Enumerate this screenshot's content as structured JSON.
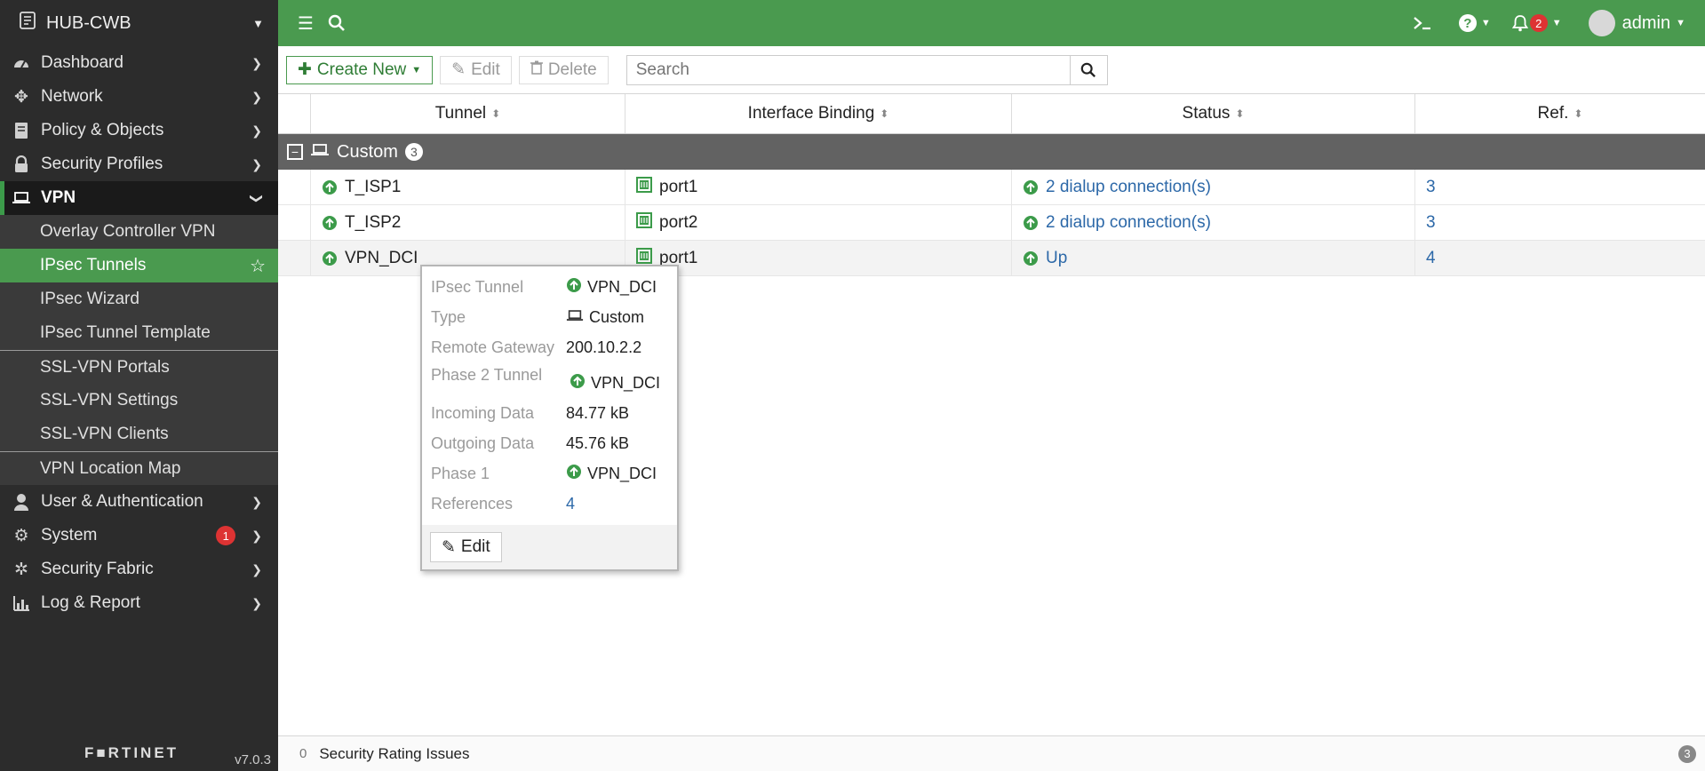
{
  "device": {
    "name": "HUB-CWB"
  },
  "sidebar": {
    "items": [
      {
        "label": "Dashboard",
        "icon": "dashboard-icon"
      },
      {
        "label": "Network",
        "icon": "network-icon"
      },
      {
        "label": "Policy & Objects",
        "icon": "policy-icon"
      },
      {
        "label": "Security Profiles",
        "icon": "lock-icon"
      },
      {
        "label": "VPN",
        "icon": "laptop-icon",
        "expanded": true
      },
      {
        "label": "User & Authentication",
        "icon": "user-icon"
      },
      {
        "label": "System",
        "icon": "gear-icon",
        "badge": "1"
      },
      {
        "label": "Security Fabric",
        "icon": "fabric-icon"
      },
      {
        "label": "Log & Report",
        "icon": "chart-icon"
      }
    ],
    "vpn_sub": [
      {
        "label": "Overlay Controller VPN"
      },
      {
        "label": "IPsec Tunnels",
        "active": true
      },
      {
        "label": "IPsec Wizard"
      },
      {
        "label": "IPsec Tunnel Template"
      },
      {
        "label": "SSL-VPN Portals"
      },
      {
        "label": "SSL-VPN Settings"
      },
      {
        "label": "SSL-VPN Clients"
      },
      {
        "label": "VPN Location Map"
      }
    ],
    "brand": "F■RTINET",
    "version": "v7.0.3"
  },
  "topbar": {
    "notifications_count": "2",
    "user": "admin"
  },
  "toolbar": {
    "create_new": "Create New",
    "edit": "Edit",
    "delete": "Delete",
    "search_placeholder": "Search"
  },
  "table": {
    "columns": [
      "Tunnel",
      "Interface Binding",
      "Status",
      "Ref."
    ],
    "group": {
      "label": "Custom",
      "count": "3"
    },
    "rows": [
      {
        "tunnel": "T_ISP1",
        "interface": "port1",
        "status": "2 dialup connection(s)",
        "ref": "3"
      },
      {
        "tunnel": "T_ISP2",
        "interface": "port2",
        "status": "2 dialup connection(s)",
        "ref": "3"
      },
      {
        "tunnel": "VPN_DCI",
        "interface": "port1",
        "status": "Up",
        "ref": "4"
      }
    ]
  },
  "tooltip": {
    "rows": [
      {
        "label": "IPsec Tunnel",
        "value": "VPN_DCI"
      },
      {
        "label": "Type",
        "value": "Custom"
      },
      {
        "label": "Remote Gateway",
        "value": "200.10.2.2"
      },
      {
        "label": "Phase 2 Tunnel",
        "value": "VPN_DCI"
      },
      {
        "label": "Incoming Data",
        "value": "84.77 kB"
      },
      {
        "label": "Outgoing Data",
        "value": "45.76 kB"
      },
      {
        "label": "Phase 1",
        "value": "VPN_DCI"
      },
      {
        "label": "References",
        "value": "4"
      }
    ],
    "edit": "Edit"
  },
  "statusbar": {
    "count": "0",
    "label": "Security Rating Issues",
    "right_count": "3"
  },
  "colors": {
    "accent_green": "#4a9a4f",
    "link_blue": "#2c68a8",
    "up_green": "#3c9b4a",
    "sidebar_bg": "#2c2c2c"
  }
}
